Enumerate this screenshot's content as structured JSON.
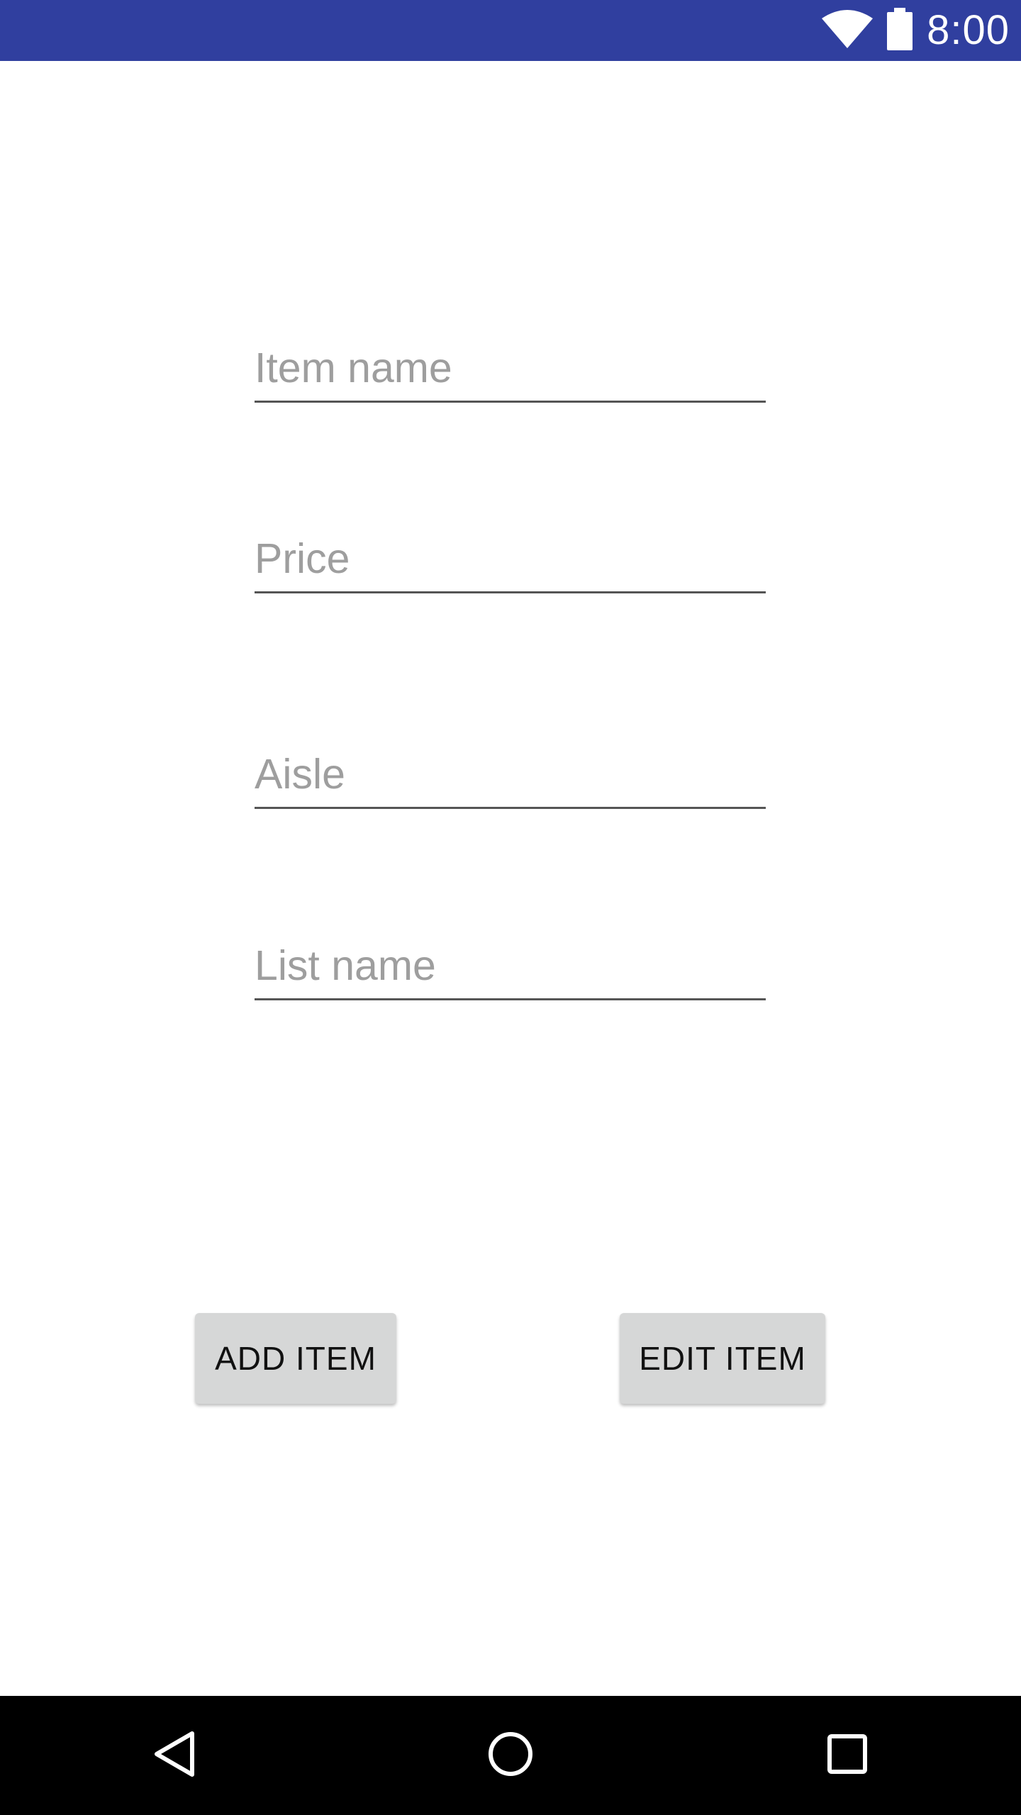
{
  "status_bar": {
    "time": "8:00",
    "background": "#303f9f",
    "icons": [
      "wifi-icon",
      "battery-icon"
    ]
  },
  "form": {
    "item_name": {
      "placeholder": "Item name",
      "value": ""
    },
    "price": {
      "placeholder": "Price",
      "value": ""
    },
    "aisle": {
      "placeholder": "Aisle",
      "value": ""
    },
    "list_name": {
      "placeholder": "List name",
      "value": ""
    }
  },
  "buttons": {
    "add_label": "ADD ITEM",
    "edit_label": "EDIT ITEM"
  },
  "nav_bar": {
    "icons": [
      "back-icon",
      "home-icon",
      "recents-icon"
    ]
  }
}
